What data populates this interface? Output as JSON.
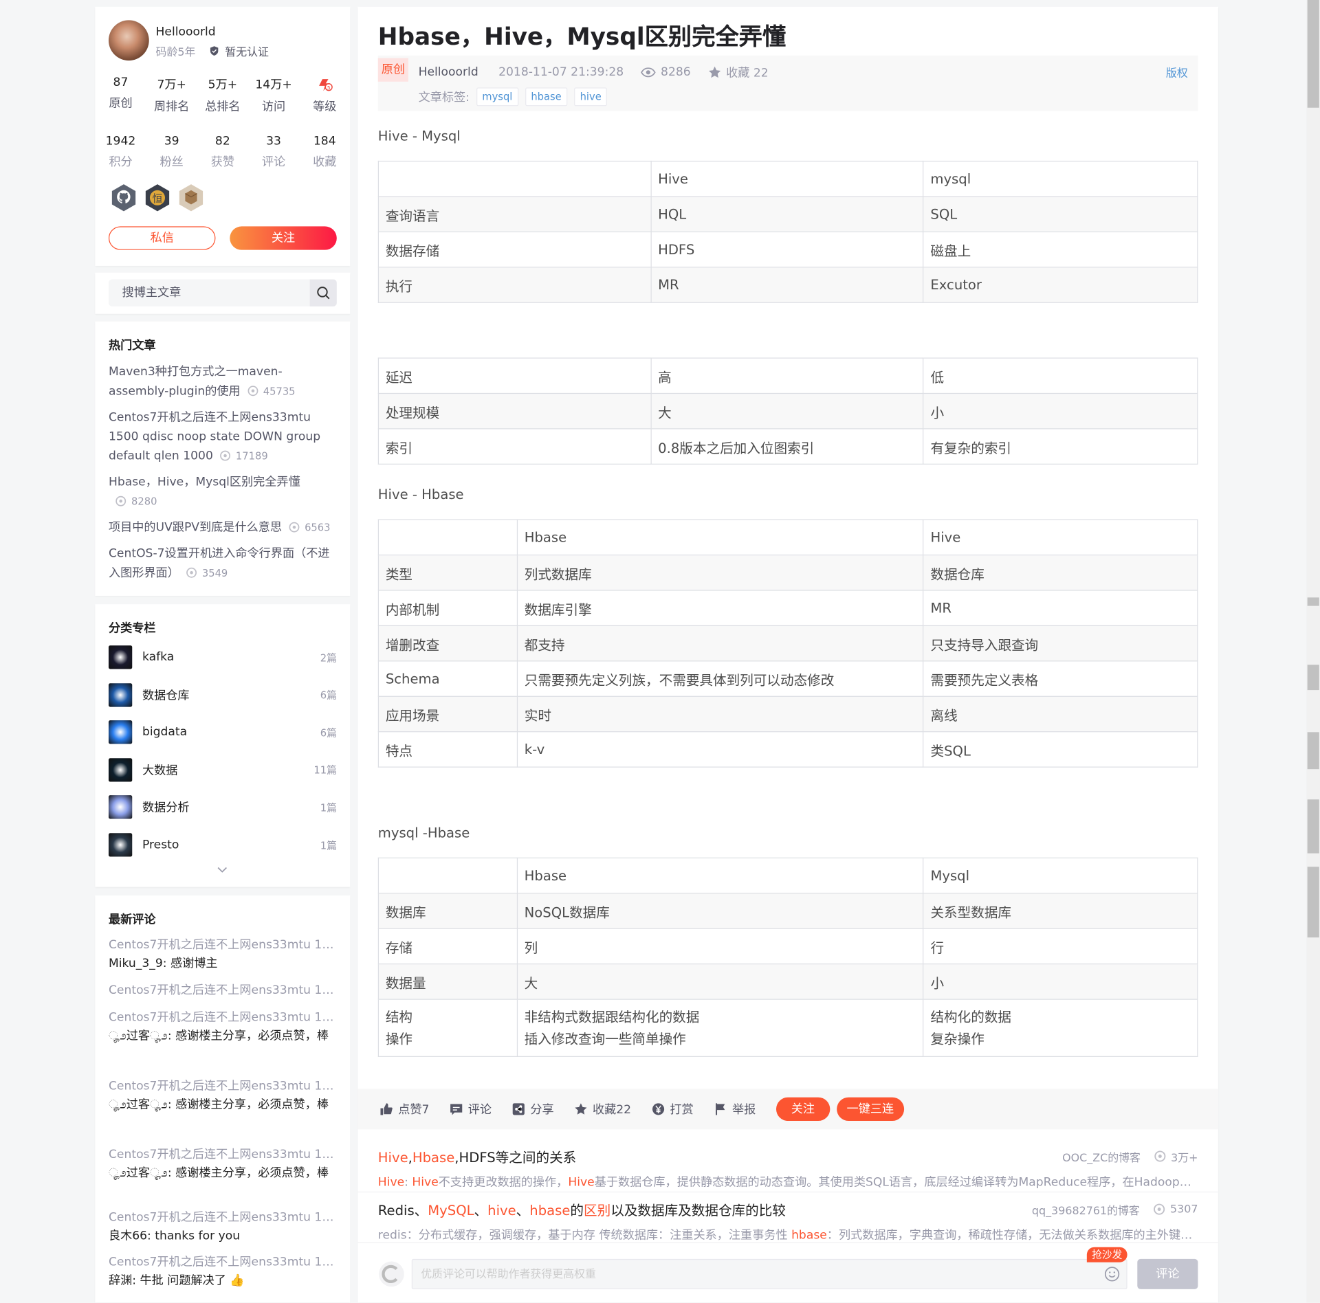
{
  "profile": {
    "name": "Hellooorld",
    "code_age": "码龄5年",
    "cert": "暂无认证",
    "stats1": [
      {
        "n": "87",
        "l": "原创"
      },
      {
        "n": "7万+",
        "l": "周排名"
      },
      {
        "n": "5万+",
        "l": "总排名"
      },
      {
        "n": "14万+",
        "l": "访问"
      },
      {
        "n": "",
        "l": "等级"
      }
    ],
    "stats2": [
      {
        "n": "1942",
        "l": "积分"
      },
      {
        "n": "39",
        "l": "粉丝"
      },
      {
        "n": "82",
        "l": "获赞"
      },
      {
        "n": "33",
        "l": "评论"
      },
      {
        "n": "184",
        "l": "收藏"
      }
    ],
    "msg_btn": "私信",
    "follow_btn": "关注"
  },
  "search": {
    "placeholder": "搜博主文章"
  },
  "hot": {
    "title": "热门文章",
    "items": [
      {
        "t": "Maven3种打包方式之一maven-assembly-plugin的使用",
        "c": "45735"
      },
      {
        "t": "Centos7开机之后连不上网ens33mtu 1500 qdisc noop state DOWN group default qlen 1000",
        "c": "17189"
      },
      {
        "t": "Hbase，Hive，Mysql区别完全弄懂",
        "c": "8280"
      },
      {
        "t": "项目中的UV跟PV到底是什么意思",
        "c": "6563"
      },
      {
        "t": "CentOS-7设置开机进入命令行界面（不进入图形界面）",
        "c": "3549"
      }
    ]
  },
  "categories": {
    "title": "分类专栏",
    "items": [
      {
        "n": "kafka",
        "c": "2篇",
        "color": "#1a1a2e"
      },
      {
        "n": "数据仓库",
        "c": "6篇",
        "color": "#1e5aa8"
      },
      {
        "n": "bigdata",
        "c": "6篇",
        "color": "#2a7ff0"
      },
      {
        "n": "大数据",
        "c": "11篇",
        "color": "#0d1f2d"
      },
      {
        "n": "数据分析",
        "c": "1篇",
        "color": "#8a9ee8"
      },
      {
        "n": "Presto",
        "c": "1篇",
        "color": "#2b3a4a"
      }
    ]
  },
  "comments": {
    "title": "最新评论",
    "items": [
      {
        "t": "Centos7开机之后连不上网ens33mtu 150...",
        "u": "Miku_3_9: 感谢博主"
      },
      {
        "t": "Centos7开机之后连不上网ens33mtu 150...",
        "u": ""
      },
      {
        "t": "Centos7开机之后连不上网ens33mtu 150...",
        "u": "ೄ೨过客ೄ೨: 感谢楼主分享，必须点赞，棒"
      },
      {
        "t": "Centos7开机之后连不上网ens33mtu 150...",
        "u": "ೄ೨过客ೄ೨: 感谢楼主分享，必须点赞，棒"
      },
      {
        "t": "Centos7开机之后连不上网ens33mtu 150...",
        "u": "ೄ೨过客ೄ೨: 感谢楼主分享，必须点赞，棒"
      },
      {
        "t": "Centos7开机之后连不上网ens33mtu 150...",
        "u": "良木66: thanks for you"
      },
      {
        "t": "Centos7开机之后连不上网ens33mtu 150...",
        "u": "辞渊: 牛批 问题解决了 👍"
      }
    ]
  },
  "article": {
    "title": "Hbase，Hive，Mysql区别完全弄懂",
    "orig": "原创",
    "author": "Hellooorld",
    "date": "2018-11-07 21:39:28",
    "views": "8286",
    "fav": "收藏 22",
    "copyright": "版权",
    "tags_label": "文章标签:",
    "tags": [
      "mysql",
      "hbase",
      "hive"
    ],
    "h1": "Hive - Mysql",
    "h2": "Hive - Hbase",
    "h3": "mysql -Hbase",
    "t1": [
      [
        "",
        "Hive",
        "mysql"
      ],
      [
        "查询语言",
        "HQL",
        "SQL"
      ],
      [
        "数据存储",
        "HDFS",
        "磁盘上"
      ],
      [
        "执行",
        "MR",
        "Excutor"
      ]
    ],
    "t2": [
      [
        "延迟",
        "高",
        "低"
      ],
      [
        "处理规模",
        "大",
        "小"
      ],
      [
        "索引",
        "0.8版本之后加入位图索引",
        "有复杂的索引"
      ]
    ],
    "t3": [
      [
        "",
        "Hbase",
        "Hive"
      ],
      [
        "类型",
        "列式数据库",
        "数据仓库"
      ],
      [
        "内部机制",
        "数据库引擎",
        "MR"
      ],
      [
        "增删改查",
        "都支持",
        "只支持导入跟查询"
      ],
      [
        "Schema",
        "只需要预先定义列族，不需要具体到列可以动态修改",
        "需要预先定义表格"
      ],
      [
        "应用场景",
        "实时",
        "离线"
      ],
      [
        "特点",
        "k-v",
        "类SQL"
      ]
    ],
    "t4": [
      [
        "",
        "Hbase",
        "Mysql"
      ],
      [
        "数据库",
        "NoSQL数据库",
        "关系型数据库"
      ],
      [
        "存储",
        "列",
        "行"
      ],
      [
        "数据量",
        "大",
        "小"
      ],
      [
        "结构\n操作",
        "非结构式数据跟结构化的数据\n插入修改查询一些简单操作",
        "结构化的数据\n复杂操作"
      ]
    ]
  },
  "toolbar": {
    "like": "点赞7",
    "comment": "评论",
    "share": "分享",
    "fav": "收藏22",
    "reward": "打赏",
    "report": "举报",
    "follow": "关注",
    "triple": "一键三连"
  },
  "recs": [
    {
      "title": "Hive,Hbase,HDFS等之间的关系",
      "src": "OOC_ZC的博客",
      "cnt": "3万+",
      "desc": "Hive:  Hive不支持更改数据的操作，Hive基于数据仓库，提供静态数据的动态查询。其使用类SQL语言，底层经过编译转为MapReduce程序，在Hadoop上运行，数据存储在HDFS上。"
    },
    {
      "title": "Redis、MySQL、hive、hbase的区别以及数据库及数据仓库的比较",
      "src": "qq_39682761的博客",
      "cnt": "5307",
      "desc": "redis：分布式缓存，强调缓存，基于内存 传统数据库：注重关系，注重事务性 hbase：列式数据库，字典查询，稀疏性存储，无法做关系数据库的主外键，用于存储海量数据"
    }
  ],
  "comment_box": {
    "placeholder": "优质评论可以帮助作者获得更高权重",
    "submit": "评论",
    "sofa": "抢沙发"
  }
}
